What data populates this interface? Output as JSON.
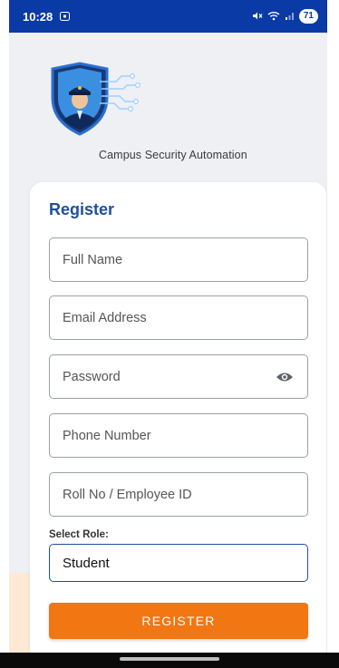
{
  "status_bar": {
    "time": "10:28",
    "battery": "71"
  },
  "app": {
    "title": "Campus Security Automation"
  },
  "form": {
    "title": "Register",
    "fields": {
      "full_name": {
        "placeholder": "Full Name"
      },
      "email": {
        "placeholder": "Email Address"
      },
      "password": {
        "placeholder": "Password"
      },
      "phone": {
        "placeholder": "Phone Number"
      },
      "roll_no": {
        "placeholder": "Roll No / Employee ID"
      }
    },
    "role": {
      "label": "Select Role:",
      "value": "Student"
    },
    "submit_label": "REGISTER"
  },
  "colors": {
    "status_bar": "#0a3aa6",
    "accent_blue": "#1f4f9c",
    "button_orange": "#f27612",
    "background": "#eef0f4"
  },
  "icons": [
    "screenshot-icon",
    "mute-icon",
    "wifi-icon",
    "signal-icon",
    "battery-icon",
    "eye-icon"
  ]
}
